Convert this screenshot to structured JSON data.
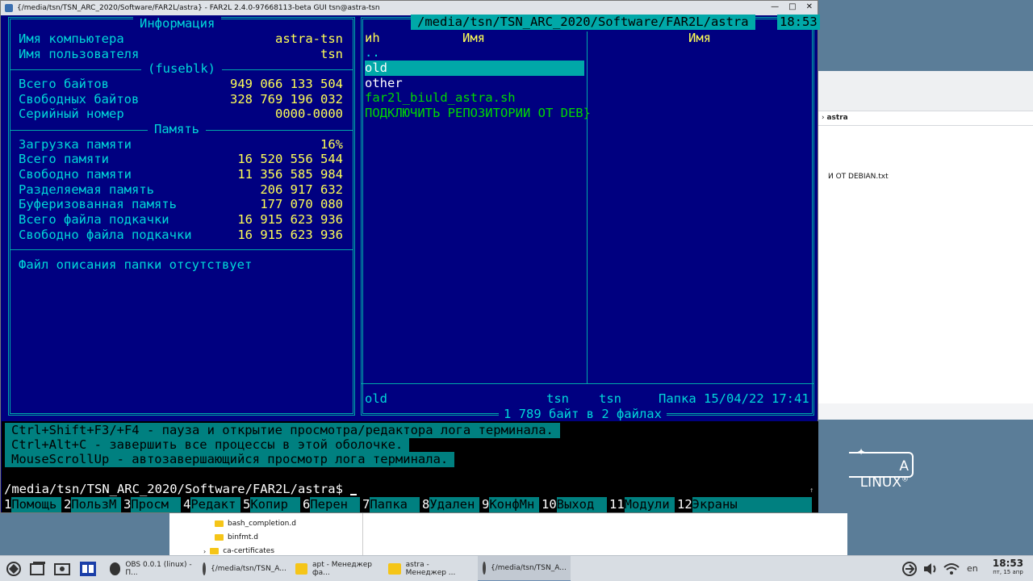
{
  "window": {
    "title": "{/media/tsn/TSN_ARC_2020/Software/FAR2L/astra} - FAR2L 2.4.0-97668113-beta GUI tsn@astra-tsn",
    "min": "—",
    "max": "□",
    "close": "✕"
  },
  "info_panel": {
    "title": "Информация",
    "computer_label": "Имя компьютера",
    "computer_value": "astra-tsn",
    "user_label": "Имя пользователя",
    "user_value": "tsn",
    "fs_title": "(fuseblk)",
    "total_bytes_label": "Всего байтов",
    "total_bytes_value": "949 066 133 504",
    "free_bytes_label": "Свободных байтов",
    "free_bytes_value": "328 769 196 032",
    "serial_label": "Серийный номер",
    "serial_value": "0000-0000",
    "memory_title": "Память",
    "mem_load_label": "Загрузка памяти",
    "mem_load_value": "16%",
    "mem_total_label": "Всего памяти",
    "mem_total_value": "16 520 556 544",
    "mem_free_label": "Свободно памяти",
    "mem_free_value": "11 356 585 984",
    "mem_shared_label": "Разделяемая память",
    "mem_shared_value": "206 917 632",
    "mem_buffered_label": "Буферизованная память",
    "mem_buffered_value": "177 070 080",
    "swap_total_label": "Всего файла подкачки",
    "swap_total_value": "16 915 623 936",
    "swap_free_label": "Свободно файла подкачки",
    "swap_free_value": "16 915 623 936",
    "description_note": "Файл описания папки отсутствует"
  },
  "file_panel": {
    "path": "/media/tsn/TSN_ARC_2020/Software/FAR2L/astra",
    "clock": "18:53",
    "col_n": "иh",
    "col_name_1": "Имя",
    "col_name_2": "Имя",
    "files": {
      "updir": "..",
      "old": "old",
      "other": "other",
      "script": "far2l_biuld_astra.sh",
      "repo": "ПОДКЛЮЧИТЬ РЕПОЗИТОРИИ ОТ DEB}"
    },
    "status": {
      "name": "old",
      "owner": "tsn",
      "group": "tsn",
      "type": "Папка",
      "datetime": "15/04/22 17:41"
    },
    "totals": "1 789 байт в 2 файлах"
  },
  "terminal": {
    "tip1": "Ctrl+Shift+F3/+F4 - пауза и открытие просмотра/редактора лога терминала.",
    "tip2": "Ctrl+Alt+C - завершить все процессы в этой оболочке.",
    "tip3": "MouseScrollUp - автозавершающийся просмотр лога терминала.",
    "prompt": "/media/tsn/TSN_ARC_2020/Software/FAR2L/astra$ ",
    "scroll_mark": "↑"
  },
  "keybar": [
    {
      "n": "1",
      "l": "Помощь"
    },
    {
      "n": "2",
      "l": "ПользМ"
    },
    {
      "n": "3",
      "l": "Просм"
    },
    {
      "n": "4",
      "l": "Редакт"
    },
    {
      "n": "5",
      "l": "Копир"
    },
    {
      "n": "6",
      "l": "Перен"
    },
    {
      "n": "7",
      "l": "Папка"
    },
    {
      "n": "8",
      "l": "Удален"
    },
    {
      "n": "9",
      "l": "КонфМн"
    },
    {
      "n": "10",
      "l": "Выход"
    },
    {
      "n": "11",
      "l": "Модули"
    },
    {
      "n": "12",
      "l": "Экраны"
    }
  ],
  "background": {
    "fm_path": "astra",
    "fm_file": "И ОТ DEBIAN.txt",
    "brand": "A LINUX",
    "brand_mark": "®",
    "tree_items": [
      "bash_completion.d",
      "binfmt.d",
      "ca-certificates"
    ]
  },
  "taskbar": {
    "tasks": [
      {
        "label": "OBS 0.0.1 (linux) - П...",
        "icon": "obs-icon"
      },
      {
        "label": "{/media/tsn/TSN_A...",
        "icon": "far-icon"
      },
      {
        "label": "apt - Менеджер фа...",
        "icon": "folder-icon"
      },
      {
        "label": "astra - Менеджер ...",
        "icon": "folder-icon"
      },
      {
        "label": "{/media/tsn/TSN_A...",
        "icon": "far-icon"
      }
    ],
    "lang": "en",
    "time": "18:53",
    "date": "пт, 15 апр"
  }
}
